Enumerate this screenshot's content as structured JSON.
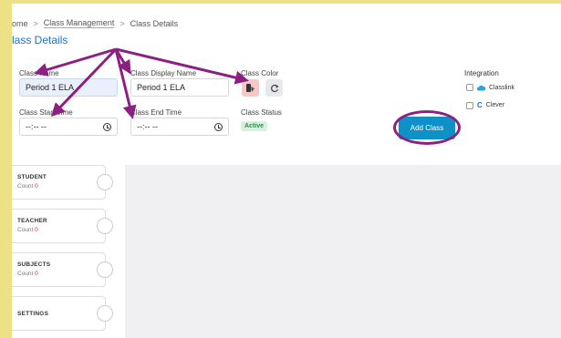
{
  "breadcrumb": {
    "home": "ome",
    "section": "Class Management",
    "current": "Class Details",
    "sep": ">"
  },
  "page": {
    "title": "lass Details"
  },
  "form": {
    "class_name": {
      "label": "Class Name",
      "value": "Period 1 ELA"
    },
    "display_name": {
      "label": "Class Display Name",
      "value": "Period 1 ELA"
    },
    "class_color": {
      "label": "Class Color"
    },
    "start_time": {
      "label": "Class Start Time",
      "value": "--:-- --"
    },
    "end_time": {
      "label": "Class End Time",
      "value": "--:-- --"
    },
    "status": {
      "label": "Class Status",
      "value": "Active"
    }
  },
  "integration": {
    "title": "Integration",
    "items": [
      {
        "label": "Classlink",
        "icon": "cloud-icon"
      },
      {
        "label": "Clever",
        "icon": "clever-c-icon",
        "glyph": "C"
      }
    ]
  },
  "actions": {
    "add_class": "Add Class"
  },
  "sidebar": {
    "count_label": "Count",
    "items": [
      {
        "name": "STUDENT",
        "count": "0"
      },
      {
        "name": "TEACHER",
        "count": "0"
      },
      {
        "name": "SUBJECTS",
        "count": "0"
      },
      {
        "name": "SETTINGS"
      }
    ]
  },
  "colors": {
    "accent": "#0d91c6",
    "annotation": "#8e1f82",
    "background": "#ece184",
    "status_active": "#2e8a49"
  }
}
